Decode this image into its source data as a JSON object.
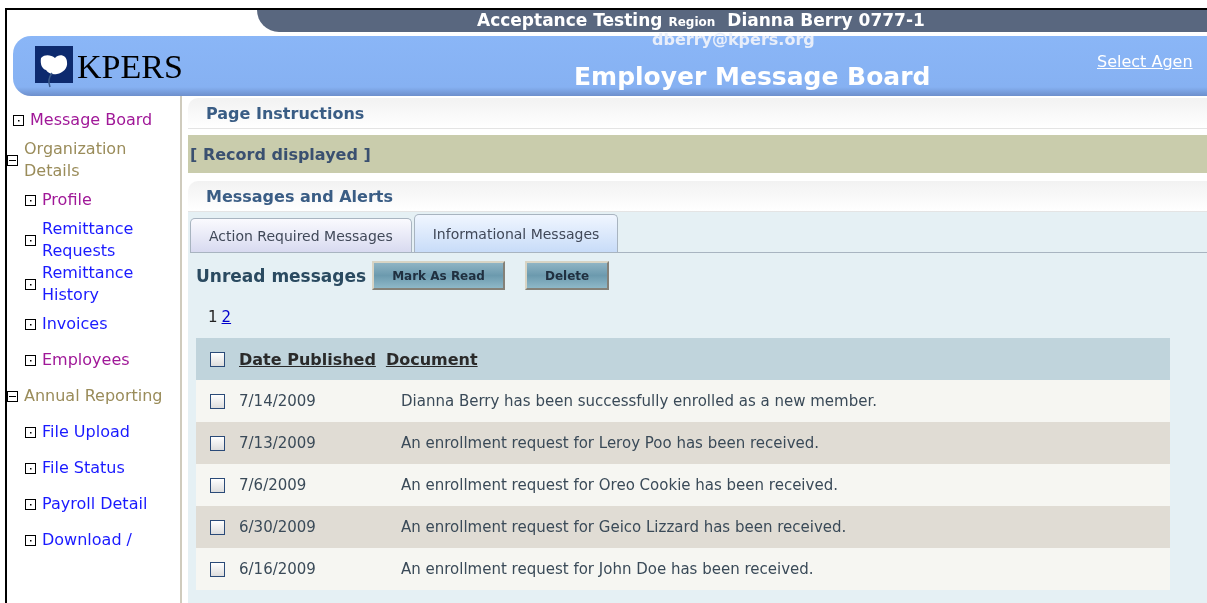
{
  "header": {
    "logo": "KPERS",
    "environment": "Acceptance Testing",
    "region_label": "Region",
    "user": "Dianna Berry 0777-1",
    "email": "dberry@kpers.org",
    "title": "Employer Message Board",
    "link": "Select Agen"
  },
  "sidebar": {
    "items": [
      {
        "kind": "leaf",
        "label": "Message Board",
        "visited": true
      },
      {
        "kind": "group",
        "label": "Organization Details",
        "expanded": true,
        "children": [
          {
            "kind": "leaf",
            "label": "Profile",
            "visited": true
          },
          {
            "kind": "leaf",
            "label": "Remittance Requests",
            "visited": false
          },
          {
            "kind": "leaf",
            "label": "Remittance History",
            "visited": false
          },
          {
            "kind": "leaf",
            "label": "Invoices",
            "visited": false
          },
          {
            "kind": "leaf",
            "label": "Employees",
            "visited": true
          }
        ]
      },
      {
        "kind": "group",
        "label": "Annual Reporting",
        "expanded": true,
        "children": [
          {
            "kind": "leaf",
            "label": "File Upload",
            "visited": false
          },
          {
            "kind": "leaf",
            "label": "File Status",
            "visited": false
          },
          {
            "kind": "leaf",
            "label": "Payroll Detail",
            "visited": false
          },
          {
            "kind": "leaf",
            "label": "Download /",
            "visited": false
          }
        ]
      }
    ]
  },
  "page_instructions": "Page Instructions",
  "record_status": "[ Record displayed ]",
  "messages": {
    "title": "Messages and Alerts",
    "tabs": [
      {
        "label": "Action Required Messages",
        "selected": false
      },
      {
        "label": "Informational Messages",
        "selected": true
      }
    ],
    "toolbar_label": "Unread messages",
    "buttons": [
      "Mark As Read",
      "Delete"
    ],
    "pages": [
      {
        "label": "1",
        "selected": true
      },
      {
        "label": "2",
        "selected": false
      }
    ],
    "table": {
      "columns": [
        "Date Published",
        "Document"
      ],
      "header_checked": false,
      "rows": [
        {
          "checked": false,
          "date": "7/14/2009",
          "document": "Dianna Berry has been successfully enrolled as a new member."
        },
        {
          "checked": false,
          "date": "7/13/2009",
          "document": "An enrollment request for Leroy Poo has been received."
        },
        {
          "checked": false,
          "date": "7/6/2009",
          "document": "An enrollment request for Oreo Cookie has been received."
        },
        {
          "checked": false,
          "date": "6/30/2009",
          "document": "An enrollment request for Geico Lizzard has been received."
        },
        {
          "checked": false,
          "date": "6/16/2009",
          "document": "An enrollment request for John Doe has been received."
        }
      ]
    }
  }
}
